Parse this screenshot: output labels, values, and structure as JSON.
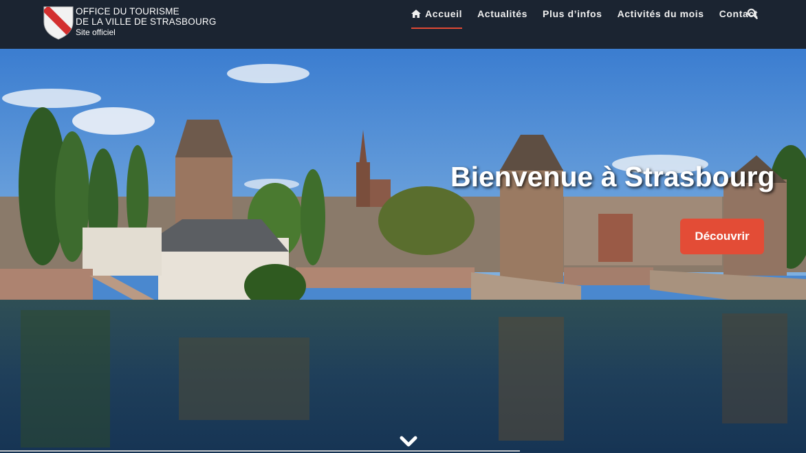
{
  "header": {
    "logo": {
      "line1": "OFFICE DU TOURISME",
      "line2": "DE LA VILLE DE STRASBOURG",
      "subtitle": "Site officiel"
    },
    "nav": [
      {
        "label": "Accueil",
        "icon": "home-icon",
        "active": true
      },
      {
        "label": "Actualités",
        "active": false
      },
      {
        "label": "Plus d’infos",
        "active": false
      },
      {
        "label": "Activités du mois",
        "active": false
      },
      {
        "label": "Contact",
        "active": false
      }
    ],
    "search_icon": "search-icon"
  },
  "hero": {
    "title": "Bienvenue à Strasbourg",
    "cta_label": "Découvrir",
    "scroll_icon": "chevron-down-icon"
  },
  "colors": {
    "header_bg": "#1b2431",
    "accent": "#e34c36",
    "active_underline": "#e14a35"
  }
}
